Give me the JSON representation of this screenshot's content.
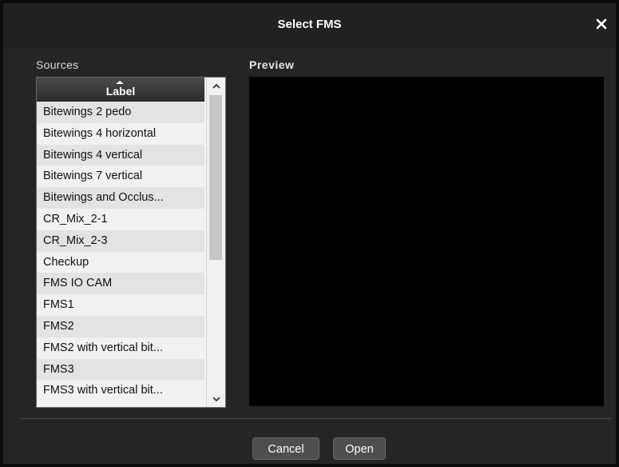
{
  "dialog": {
    "title": "Select FMS",
    "close_icon": "close-icon"
  },
  "sources": {
    "label": "Sources",
    "column_header": "Label",
    "sort_icon": "sort-ascending-icon",
    "items": [
      "Bitewings 2 pedo",
      "Bitewings 4 horizontal",
      "Bitewings 4 vertical",
      "Bitewings 7 vertical",
      "Bitewings and Occlus...",
      "CR_Mix_2-1",
      "CR_Mix_2-3",
      "Checkup",
      "FMS IO CAM",
      "FMS1",
      "FMS2",
      "FMS2 with vertical bit...",
      "FMS3",
      "FMS3 with vertical bit..."
    ]
  },
  "preview": {
    "label": "Preview"
  },
  "buttons": {
    "cancel": "Cancel",
    "open": "Open"
  },
  "colors": {
    "dialog_bg": "#252525",
    "preview_bg": "#000000",
    "row_alt": "#e3e3e3",
    "row_base": "#f1f1f1",
    "button_bg": "#4e4e4e"
  }
}
